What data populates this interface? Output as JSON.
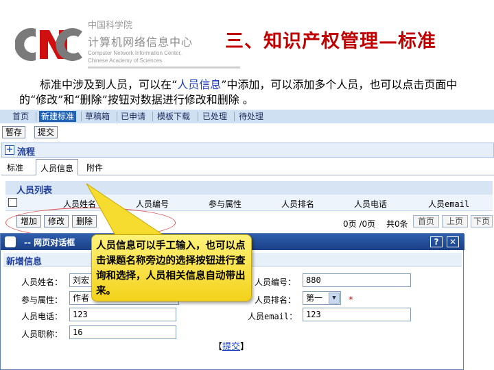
{
  "header": {
    "org_cas": "中国科学院",
    "org_cnic": "计算机网络信息中心",
    "org_en_line1": "Computer Network Information Center,",
    "org_en_line2": "Chinese Academy of Sciences",
    "slide_title": "三、知识产权管理—标准",
    "logo_icon": "cnic-logo-icon"
  },
  "description": {
    "part1": "标准中涉及到人员，可以在“",
    "highlight": "人员信息",
    "part2": "”中添加，可以添加多个人员，也可以点击页面中的“修改”和“删除”按钮对数据进行修改和删除 。"
  },
  "nav": {
    "tabs": [
      "首页",
      "新建标准",
      "草稿箱",
      "已申请",
      "模板下载",
      "已处理",
      "待处理"
    ],
    "active": "新建标准"
  },
  "toolbar": {
    "save": "暂存",
    "submit": "提交"
  },
  "flow": {
    "label": "流程"
  },
  "subtabs": {
    "standard": "标准",
    "personnel": "人员信息",
    "attachment": "附件"
  },
  "list": {
    "title": "人员列表",
    "columns": [
      "人员姓名",
      "人员编号",
      "参与属性",
      "人员排名",
      "人员电话",
      "人员email"
    ],
    "add": "增加",
    "edit": "修改",
    "delete": "删除",
    "page_status": "0页 /0页",
    "total": "共0条",
    "first": "首页",
    "prev": "上页",
    "next": "下页"
  },
  "dialog": {
    "title": "-- 网页对话框",
    "section": "新增信息",
    "help_icon": "?",
    "close_icon": "✕",
    "name_label": "人员姓名：",
    "name_value": "刘宏",
    "id_label": "人员编号：",
    "id_value": "880",
    "attr_label": "参与属性：",
    "attr_value": "作者",
    "rank_label": "人员排名：",
    "rank_value": "第一",
    "required_mark": "*",
    "phone_label": "人员电话：",
    "phone_value": "123",
    "email_label": "人员email：",
    "email_value": "123",
    "title_label": "人员职称：",
    "title_value": "16",
    "submit_open": "【",
    "submit": "提交",
    "submit_close": "】"
  },
  "callout": {
    "text": "人员信息可以手工输入，也可以点击课题名称旁边的选择按钮进行查询和选择，人员相关信息自动带出来。"
  },
  "colors": {
    "title_red": "#c00000",
    "nav_active": "#1e62b8",
    "dialog_title": "#2f5fae",
    "callout_yellow": "#f3d21a",
    "highlight_blue": "#1f3fbf"
  }
}
